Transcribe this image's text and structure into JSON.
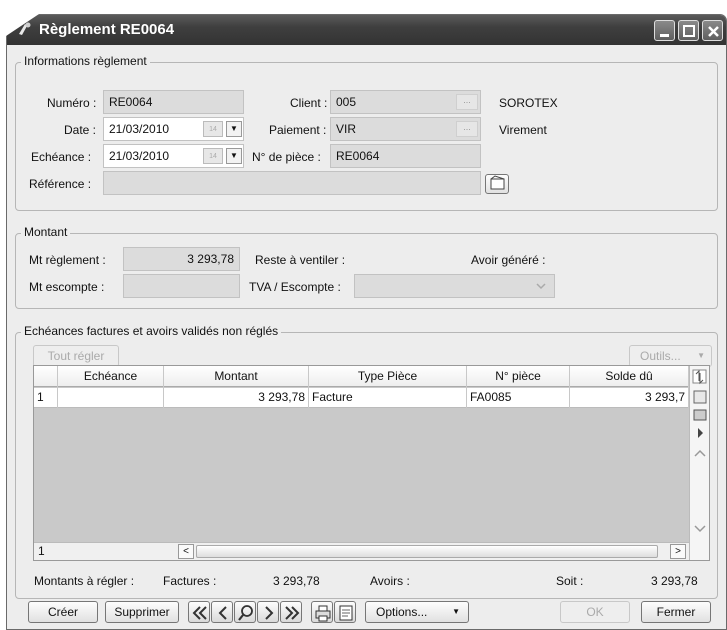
{
  "window": {
    "title": "Règlement RE0064"
  },
  "info": {
    "legend": "Informations règlement",
    "numero_label": "Numéro :",
    "numero": "RE0064",
    "client_label": "Client :",
    "client": "005",
    "client_name": "SOROTEX",
    "date_label": "Date :",
    "date": "21/03/2010",
    "paiement_label": "Paiement :",
    "paiement": "VIR",
    "paiement_name": "Virement",
    "echeance_label": "Echéance :",
    "echeance": "21/03/2010",
    "npiece_label": "N° de pièce :",
    "npiece": "RE0064",
    "reference_label": "Référence :",
    "reference": "",
    "cal_day": "14"
  },
  "montant": {
    "legend": "Montant",
    "mt_reglement_label": "Mt règlement :",
    "mt_reglement": "3 293,78",
    "reste_label": "Reste à ventiler :",
    "avoir_label": "Avoir généré :",
    "mt_escompte_label": "Mt escompte :",
    "mt_escompte": "",
    "tva_label": "TVA / Escompte :",
    "tva": ""
  },
  "echeances": {
    "legend": "Echéances factures et avoirs validés non réglés",
    "tout_regler": "Tout régler",
    "outils": "Outils...",
    "columns": [
      "Echéance",
      "Montant",
      "Type Pièce",
      "N° pièce",
      "Solde dû"
    ],
    "rows": [
      {
        "num": "1",
        "echeance": "",
        "montant": "3 293,78",
        "type": "Facture",
        "npiece": "FA0085",
        "solde": "3 293,7"
      }
    ],
    "footer_count": "1"
  },
  "totals": {
    "label": "Montants à régler :",
    "factures_label": "Factures :",
    "factures": "3 293,78",
    "avoirs_label": "Avoirs :",
    "soit_label": "Soit :",
    "soit": "3 293,78"
  },
  "buttons": {
    "creer": "Créer",
    "supprimer": "Supprimer",
    "options": "Options...",
    "ok": "OK",
    "fermer": "Fermer"
  },
  "colors": {
    "titlebar": "#3f3f3f",
    "window_bg": "#ededed",
    "field_bg": "#dcdcdc"
  }
}
